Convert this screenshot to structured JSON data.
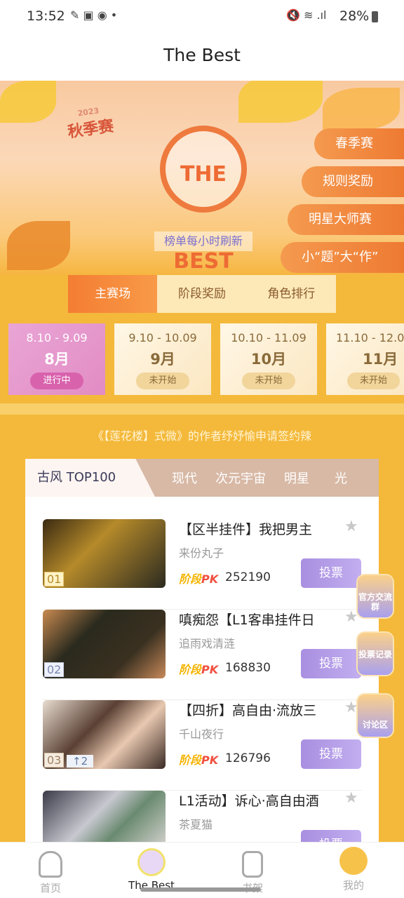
{
  "status_bar": {
    "time": "13:52",
    "battery": "28%"
  },
  "header": {
    "title": "The Best"
  },
  "banner": {
    "season_badge": "秋季赛",
    "season_year": "2023",
    "logo_text": "THE BEST",
    "refresh_note": "榜单每小时刷新",
    "side_buttons": [
      "春季赛",
      "规则奖励",
      "明星大师赛",
      "小“题”大“作”"
    ]
  },
  "tabs": [
    {
      "label": "主赛场",
      "active": true
    },
    {
      "label": "阶段奖励"
    },
    {
      "label": "角色排行"
    }
  ],
  "months": [
    {
      "range": "8.10 - 9.09",
      "month": "8月",
      "status": "进行中",
      "active": true
    },
    {
      "range": "9.10 - 10.09",
      "month": "9月",
      "status": "未开始"
    },
    {
      "range": "10.10 - 11.09",
      "month": "10月",
      "status": "未开始"
    },
    {
      "range": "11.10 - 12.0",
      "month": "11月",
      "status": "未开始"
    }
  ],
  "notice": "《【莲花楼】式微》的作者纾妤愉申请签约辣",
  "categories": [
    "古风 TOP100",
    "现代",
    "次元宇宙",
    "明星",
    "光"
  ],
  "pk_label": "阶段",
  "pk_mark": "PK",
  "vote_label": "投票",
  "items": [
    {
      "rank": "01",
      "title": "【区半挂件】我把男主",
      "author": "来份丸子",
      "score": "252190"
    },
    {
      "rank": "02",
      "title": "嗔痴怨【L1客串挂件日",
      "author": "追雨戏清涟",
      "score": "168830"
    },
    {
      "rank": "03",
      "rank_change": "↑2",
      "title": "【四折】高自由·流放三",
      "author": "千山夜行",
      "score": "126796"
    },
    {
      "title": "L1活动】诉心·高自由酒",
      "author": "茶夏猫"
    }
  ],
  "floating": [
    "官方交流群",
    "投票记录",
    "讨论区"
  ],
  "nav": [
    {
      "label": "首页"
    },
    {
      "label": "The Best",
      "active": true
    },
    {
      "label": "书架"
    },
    {
      "label": "我的"
    }
  ],
  "colors": {
    "page_bg": "#f4b93a",
    "accent_orange": "#f47d32",
    "vote_purple": "#a98fe0",
    "active_month": "#e28cc4"
  }
}
